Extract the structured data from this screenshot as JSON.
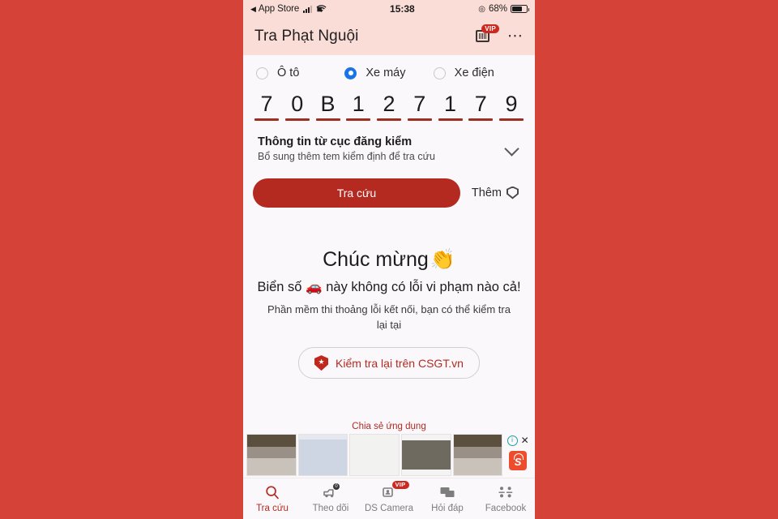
{
  "status_bar": {
    "back_label": "App Store",
    "back_arrow": "back-triangle-icon",
    "time": "15:38",
    "battery_percent": "68%",
    "battery_level": 68,
    "icons": [
      "signal-bars-icon",
      "wifi-icon",
      "location-icon",
      "battery-icon"
    ]
  },
  "app_bar": {
    "title": "Tra Phạt Nguội",
    "vip_badge": "VIP",
    "card_icon": "id-card-icon",
    "more_icon": "more-horizontal-icon"
  },
  "vehicle_types": [
    {
      "label": "Ô tô",
      "selected": false
    },
    {
      "label": "Xe máy",
      "selected": true
    },
    {
      "label": "Xe điện",
      "selected": false
    }
  ],
  "plate": {
    "characters": [
      "7",
      "0",
      "B",
      "1",
      "2",
      "7",
      "1",
      "7",
      "9"
    ],
    "underline_color": "#9e2d22"
  },
  "registry": {
    "title": "Thông tin từ cục đăng kiểm",
    "subtitle": "Bổ sung thêm tem kiểm định để tra cứu",
    "chevron_icon": "chevron-down-icon"
  },
  "actions": {
    "search_label": "Tra cứu",
    "more_label": "Thêm",
    "more_icon": "shield-icon"
  },
  "result": {
    "title": "Chúc mừng",
    "title_emoji": "👏",
    "main_prefix": "Biển số",
    "main_emoji": "🚗",
    "main_suffix": "này không có lỗi vi phạm nào cả!",
    "note": "Phần mềm thi thoảng lỗi kết nối, bạn có thể kiểm tra lại tại",
    "csgt_button_label": "Kiểm tra lại trên CSGT.vn",
    "csgt_icon": "shield-star-icon"
  },
  "ad": {
    "title": "Chia sẻ ứng dụng",
    "info_icon": "info-icon",
    "close_icon": "close-icon",
    "brand_icon": "shopee-icon",
    "thumbnails": [
      "ad-thumb-1",
      "ad-thumb-2",
      "ad-thumb-3",
      "ad-thumb-4",
      "ad-thumb-5"
    ]
  },
  "tabbar": [
    {
      "label": "Tra cứu",
      "icon": "search-icon",
      "active": true,
      "badge": ""
    },
    {
      "label": "Theo dõi",
      "icon": "car-tracking-icon",
      "active": false,
      "badge": "0"
    },
    {
      "label": "DS Camera",
      "icon": "camera-list-icon",
      "active": false,
      "badge": "VIP"
    },
    {
      "label": "Hỏi đáp",
      "icon": "chat-icon",
      "active": false,
      "badge": ""
    },
    {
      "label": "Facebook",
      "icon": "facebook-group-icon",
      "active": false,
      "badge": ""
    }
  ],
  "colors": {
    "page_background": "#d44238",
    "header_background": "#f9ddd6",
    "content_background": "#fbf8fb",
    "primary_red": "#b42a20",
    "radio_selected_blue": "#1a73e8",
    "shopee_orange": "#ee4d2d"
  }
}
